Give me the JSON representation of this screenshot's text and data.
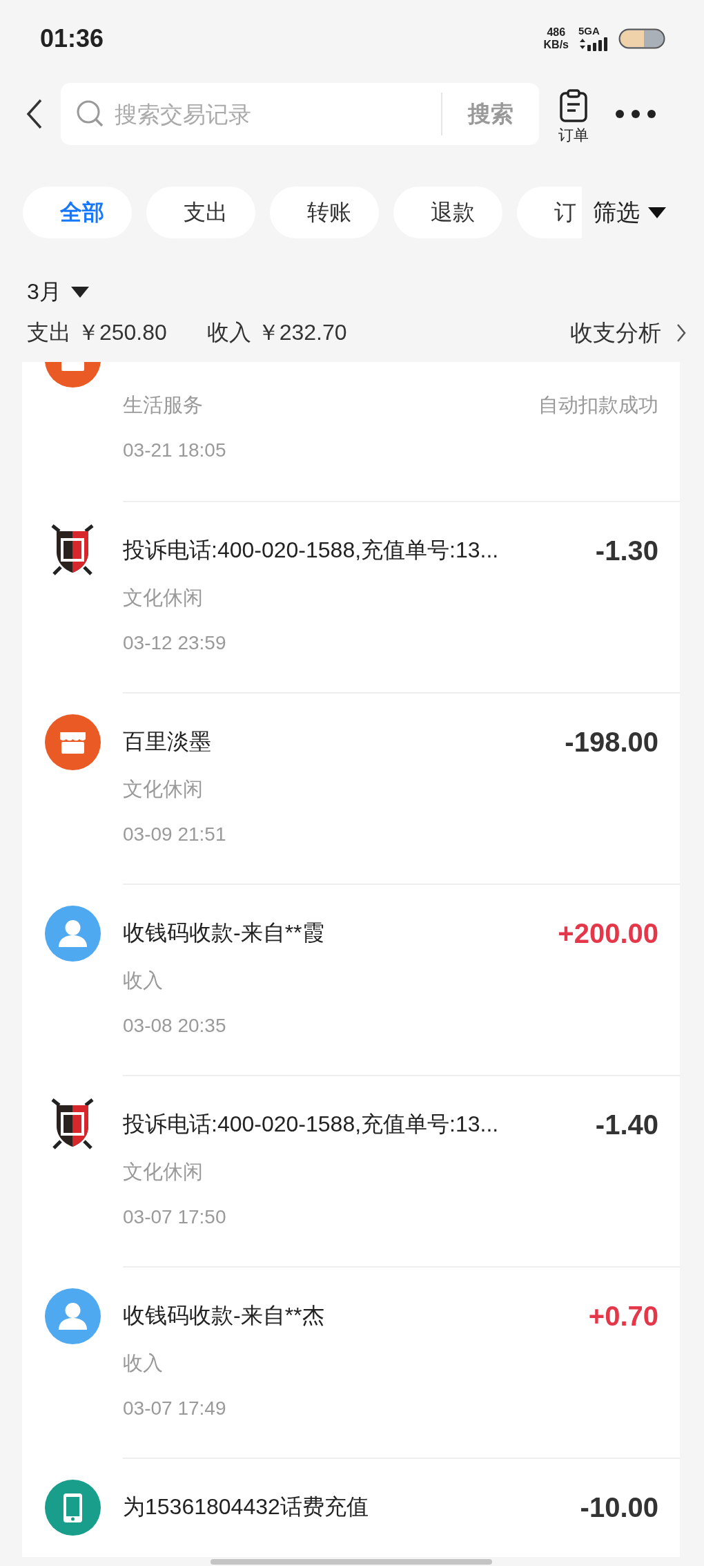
{
  "status_bar": {
    "time": "01:36",
    "net_speed": "486",
    "net_speed_unit": "KB/s",
    "network": "5GA"
  },
  "header": {
    "search_placeholder": "搜索交易记录",
    "search_button": "搜索",
    "orders_label": "订单"
  },
  "filter_tabs": [
    {
      "label": "全部",
      "selected": true
    },
    {
      "label": "支出",
      "selected": false
    },
    {
      "label": "转账",
      "selected": false
    },
    {
      "label": "退款",
      "selected": false
    },
    {
      "label": "订",
      "selected": false
    }
  ],
  "filter_button": "筛选",
  "month": "3月",
  "summary": {
    "expense": "支出 ￥250.80",
    "income": "收入 ￥232.70",
    "analysis": "收支分析"
  },
  "transactions": [
    {
      "kind": "store",
      "category": "生活服务",
      "status": "自动扣款成功",
      "date": "03-21 18:05"
    },
    {
      "kind": "shield",
      "title": "投诉电话:400-020-1588,充值单号:13...",
      "amount": "-1.30",
      "color": "#333333",
      "category": "文化休闲",
      "date": "03-12 23:59"
    },
    {
      "kind": "store",
      "title": "百里淡墨",
      "amount": "-198.00",
      "color": "#333333",
      "category": "文化休闲",
      "date": "03-09 21:51"
    },
    {
      "kind": "person",
      "title": "收钱码收款-来自**霞",
      "amount": "+200.00",
      "color": "#e5374a",
      "category": "收入",
      "date": "03-08 20:35"
    },
    {
      "kind": "shield",
      "title": "投诉电话:400-020-1588,充值单号:13...",
      "amount": "-1.40",
      "color": "#333333",
      "category": "文化休闲",
      "date": "03-07 17:50"
    },
    {
      "kind": "person",
      "title": "收钱码收款-来自**杰",
      "amount": "+0.70",
      "color": "#e5374a",
      "category": "收入",
      "date": "03-07 17:49"
    },
    {
      "kind": "phone",
      "title": "为15361804432话费充值",
      "amount": "-10.00",
      "color": "#333333"
    }
  ]
}
